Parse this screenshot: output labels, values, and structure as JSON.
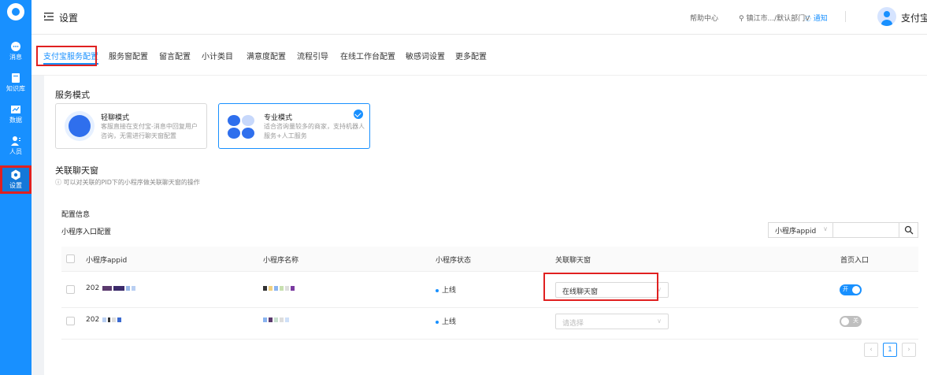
{
  "rail": {
    "items": [
      {
        "label": "消息",
        "icon": "message-icon"
      },
      {
        "label": "知识库",
        "icon": "book-icon"
      },
      {
        "label": "数据",
        "icon": "chart-icon"
      },
      {
        "label": "人员",
        "icon": "people-icon"
      },
      {
        "label": "设置",
        "icon": "gear-icon"
      }
    ]
  },
  "header": {
    "title": "设置",
    "help": "帮助中心",
    "org": "镇江市.../默认部门V",
    "notify": "通知",
    "user": "支付宝."
  },
  "tabs": [
    "支付宝服务配置",
    "服务窗配置",
    "留言配置",
    "小计类目",
    "满意度配置",
    "流程引导",
    "在线工作台配置",
    "敏感词设置",
    "更多配置"
  ],
  "service_mode": {
    "title": "服务模式",
    "options": [
      {
        "title": "轻聊模式",
        "desc": "客服直接在支付宝-消息中回复用户咨询，无需进行聊天窗配置",
        "selected": false
      },
      {
        "title": "专业模式",
        "desc": "适合咨询量较多的商家，支持机器人服务+人工服务",
        "selected": true
      }
    ]
  },
  "related_chat": {
    "title": "关联聊天窗",
    "hint": "ⓘ 可以对关联的PID下的小程序做关联聊天窗的操作"
  },
  "config": {
    "title": "配置信息",
    "subtitle": "小程序入口配置",
    "search_select": "小程序appid",
    "search_placeholder": ""
  },
  "table": {
    "headers": [
      "小程序appid",
      "小程序名称",
      "小程序状态",
      "关联聊天窗",
      "首页入口"
    ],
    "rows": [
      {
        "appid": "202",
        "status": "上线",
        "chat": "在线聊天窗",
        "chat_placeholder": false,
        "switch_label": "开",
        "switch_on": true
      },
      {
        "appid": "202",
        "status": "上线",
        "chat": "请选择",
        "chat_placeholder": true,
        "switch_label": "关",
        "switch_on": false
      }
    ]
  },
  "pagination": {
    "current": "1"
  },
  "colors": {
    "accent": "#1890ff",
    "highlight": "#e02020"
  }
}
